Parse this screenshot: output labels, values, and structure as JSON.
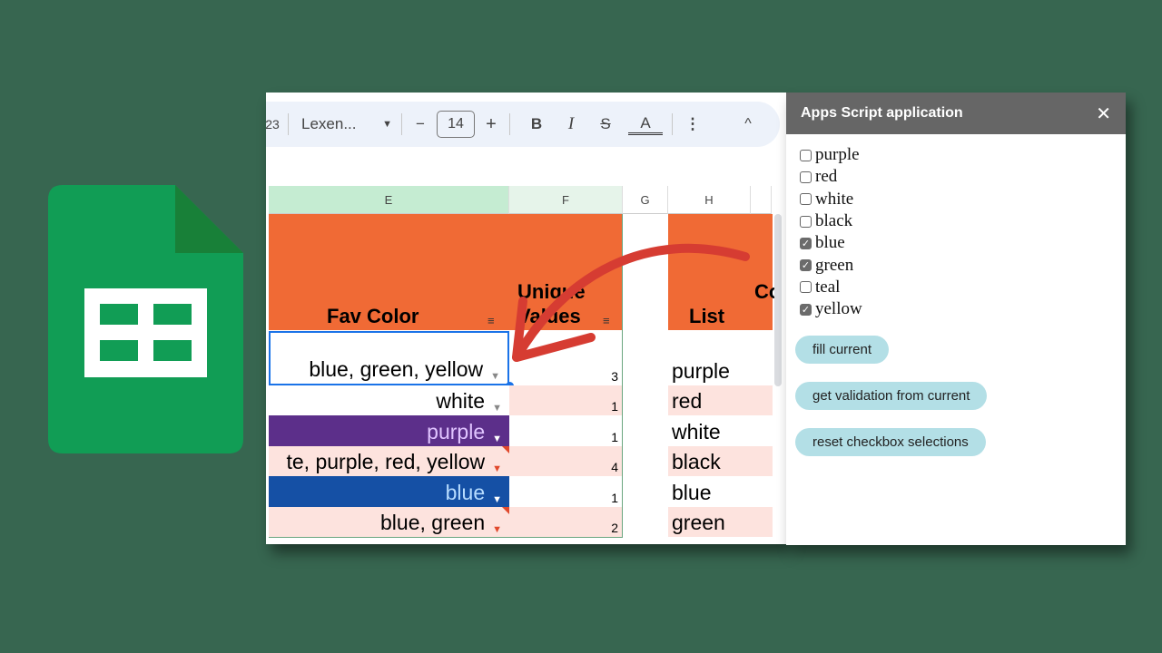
{
  "toolbar": {
    "partial_label": "23",
    "font_name": "Lexen...",
    "font_size": "14",
    "minus": "−",
    "plus": "+",
    "bold": "B",
    "italic": "I",
    "strike": "S",
    "text_color": "A",
    "more": "⋮",
    "collapse": "^"
  },
  "columns": [
    "E",
    "F",
    "G",
    "H"
  ],
  "headers": {
    "fav_color": "Fav Color",
    "unique_values_1": "Unique",
    "unique_values_2": "Values",
    "list": "List",
    "partial": "Co"
  },
  "rows": [
    {
      "fav": "blue, green, yellow",
      "count": "3",
      "list": "purple"
    },
    {
      "fav": "white",
      "count": "1",
      "list": "red"
    },
    {
      "fav": "purple",
      "count": "1",
      "list": "white"
    },
    {
      "fav": "te, purple, red, yellow",
      "count": "4",
      "list": "black"
    },
    {
      "fav": "blue",
      "count": "1",
      "list": "blue"
    },
    {
      "fav": "blue, green",
      "count": "2",
      "list": "green"
    }
  ],
  "dialog": {
    "title": "Apps Script application",
    "close": "✕",
    "options": [
      {
        "label": "purple",
        "checked": false
      },
      {
        "label": "red",
        "checked": false
      },
      {
        "label": "white",
        "checked": false
      },
      {
        "label": "black",
        "checked": false
      },
      {
        "label": "blue",
        "checked": true
      },
      {
        "label": "green",
        "checked": true
      },
      {
        "label": "teal",
        "checked": false
      },
      {
        "label": "yellow",
        "checked": true
      }
    ],
    "buttons": [
      "fill current",
      "get validation from current",
      "reset checkbox selections"
    ]
  },
  "colors": {
    "background": "#376650",
    "header_orange": "#f06a35",
    "purple_cell": "#5c2f8a",
    "blue_cell": "#1550a5",
    "pink_row": "#fde3de",
    "button": "#b3dfe6"
  }
}
